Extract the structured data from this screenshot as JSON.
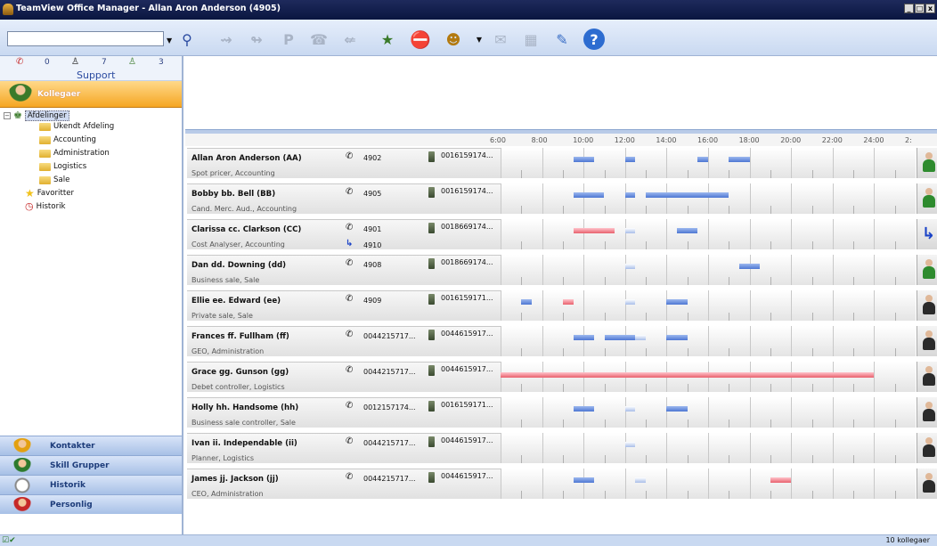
{
  "window": {
    "title": "TeamView Office Manager - Allan Aron Anderson (4905)"
  },
  "toolbar": {
    "search_value": ""
  },
  "stats": {
    "count1": "0",
    "count2": "7",
    "count3": "3",
    "label": "Support"
  },
  "nav": {
    "active": "Kollegaer",
    "bottom": [
      "Kontakter",
      "Skill Grupper",
      "Historik",
      "Personlig"
    ]
  },
  "tree": {
    "root": "Afdelinger",
    "departments": [
      "Ukendt Afdeling",
      "Accounting",
      "Administration",
      "Logistics",
      "Sale"
    ],
    "favorites": "Favoritter",
    "history": "Historik"
  },
  "timeline": {
    "hours": [
      "6:00",
      "8:00",
      "10:00",
      "12:00",
      "14:00",
      "16:00",
      "18:00",
      "20:00",
      "22:00",
      "24:00",
      "2:"
    ]
  },
  "colleagues": [
    {
      "name": "Allan Aron Anderson (AA)",
      "subtitle": "Spot pricer, Accounting",
      "ext": "4902",
      "mobile": "0016159174...",
      "status": "green",
      "bars": [
        {
          "start": 9.5,
          "end": 10.5,
          "type": "blue"
        },
        {
          "start": 12,
          "end": 12.5,
          "type": "blue"
        },
        {
          "start": 15.5,
          "end": 16,
          "type": "blue"
        },
        {
          "start": 17,
          "end": 18,
          "type": "blue"
        }
      ]
    },
    {
      "name": "Bobby bb. Bell (BB)",
      "subtitle": "Cand. Merc. Aud., Accounting",
      "ext": "4905",
      "mobile": "0016159174...",
      "status": "green",
      "bars": [
        {
          "start": 9.5,
          "end": 11,
          "type": "blue"
        },
        {
          "start": 12,
          "end": 12.5,
          "type": "blue"
        },
        {
          "start": 13,
          "end": 17,
          "type": "blue"
        }
      ]
    },
    {
      "name": "Clarissa cc. Clarkson (CC)",
      "subtitle": "Cost Analyser, Accounting",
      "ext": "4901",
      "forward": "4910",
      "mobile": "0018669174...",
      "status": "forward",
      "bars": [
        {
          "start": 9.5,
          "end": 11.5,
          "type": "pink"
        },
        {
          "start": 12,
          "end": 12.5,
          "type": "fade"
        },
        {
          "start": 14.5,
          "end": 15.5,
          "type": "blue"
        }
      ]
    },
    {
      "name": "Dan dd. Downing (dd)",
      "subtitle": "Business sale, Sale",
      "ext": "4908",
      "mobile": "0018669174...",
      "status": "green",
      "bars": [
        {
          "start": 12,
          "end": 12.5,
          "type": "fade"
        },
        {
          "start": 17.5,
          "end": 18.5,
          "type": "blue"
        }
      ]
    },
    {
      "name": "Ellie ee. Edward (ee)",
      "subtitle": "Private sale, Sale",
      "ext": "4909",
      "mobile": "0016159171...",
      "status": "dark",
      "bars": [
        {
          "start": 7,
          "end": 7.5,
          "type": "blue"
        },
        {
          "start": 9,
          "end": 9.5,
          "type": "pink"
        },
        {
          "start": 12,
          "end": 12.5,
          "type": "fade"
        },
        {
          "start": 14,
          "end": 15,
          "type": "blue"
        }
      ]
    },
    {
      "name": "Frances ff. Fullham (ff)",
      "subtitle": "GEO, Administration",
      "ext": "0044215717...",
      "mobile": "0044615917...",
      "status": "dark",
      "bars": [
        {
          "start": 9.5,
          "end": 10.5,
          "type": "blue"
        },
        {
          "start": 11,
          "end": 12.5,
          "type": "blue"
        },
        {
          "start": 12.5,
          "end": 13,
          "type": "fade"
        },
        {
          "start": 14,
          "end": 15,
          "type": "blue"
        }
      ]
    },
    {
      "name": "Grace gg. Gunson (gg)",
      "subtitle": "Debet controller, Logistics",
      "ext": "0044215717...",
      "mobile": "0044615917...",
      "status": "dark",
      "bars": [
        {
          "start": 6,
          "end": 24,
          "type": "pink"
        }
      ]
    },
    {
      "name": "Holly hh. Handsome (hh)",
      "subtitle": "Business sale controller, Sale",
      "ext": "0012157174...",
      "mobile": "0016159171...",
      "status": "dark",
      "bars": [
        {
          "start": 9.5,
          "end": 10.5,
          "type": "blue"
        },
        {
          "start": 12,
          "end": 12.5,
          "type": "fade"
        },
        {
          "start": 14,
          "end": 15,
          "type": "blue"
        }
      ]
    },
    {
      "name": "Ivan ii. Independable (ii)",
      "subtitle": "Planner, Logistics",
      "ext": "0044215717...",
      "mobile": "0044615917...",
      "status": "dark",
      "bars": [
        {
          "start": 12,
          "end": 12.5,
          "type": "fade"
        }
      ]
    },
    {
      "name": "James jj. Jackson (jj)",
      "subtitle": "CEO, Administration",
      "ext": "0044215717...",
      "mobile": "0044615917...",
      "status": "dark",
      "bars": [
        {
          "start": 9.5,
          "end": 10.5,
          "type": "blue"
        },
        {
          "start": 12.5,
          "end": 13,
          "type": "fade"
        },
        {
          "start": 19,
          "end": 20,
          "type": "pink"
        }
      ]
    }
  ],
  "status_count": "10 kollegaer"
}
